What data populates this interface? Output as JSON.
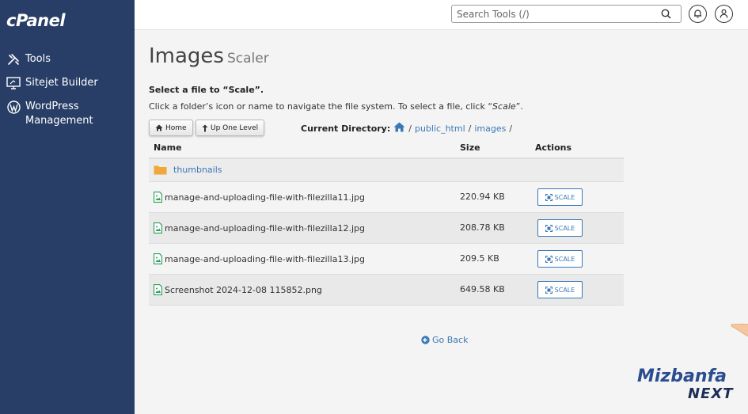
{
  "sidebar": {
    "logo": "cPanel",
    "items": [
      {
        "label": "Tools",
        "icon": "tools-icon"
      },
      {
        "label": "Sitejet Builder",
        "icon": "monitor-icon"
      },
      {
        "label": "WordPress Management",
        "icon": "wordpress-icon"
      }
    ]
  },
  "topbar": {
    "search_placeholder": "Search Tools (/)"
  },
  "page": {
    "title": "Images",
    "subtitle": "Scaler",
    "instruction_bold": "Select a file to “Scale”.",
    "instruction_prefix": "Click a folder’s icon or name to navigate the file system. To select a file, click “",
    "instruction_em": "Scale",
    "instruction_suffix": "”."
  },
  "toolbar": {
    "home_label": "Home",
    "up_label": "Up One Level"
  },
  "current_directory": {
    "label": "Current Directory:",
    "path": [
      "public_html",
      "images"
    ],
    "trailing_sep": "/"
  },
  "table": {
    "headers": {
      "name": "Name",
      "size": "Size",
      "actions": "Actions"
    },
    "folder": {
      "name": "thumbnails"
    },
    "files": [
      {
        "name": "manage-and-uploading-file-with-filezilla11.jpg",
        "size": "220.94 KB",
        "action": "SCALE"
      },
      {
        "name": "manage-and-uploading-file-with-filezilla12.jpg",
        "size": "208.78 KB",
        "action": "SCALE"
      },
      {
        "name": "manage-and-uploading-file-with-filezilla13.jpg",
        "size": "209.5 KB",
        "action": "SCALE"
      },
      {
        "name": "Screenshot 2024-12-08 115852.png",
        "size": "649.58 KB",
        "action": "SCALE"
      }
    ]
  },
  "footer": {
    "go_back": "Go Back"
  },
  "watermark": {
    "line1": "Mizbanfa",
    "line2": "NEXT"
  },
  "colors": {
    "sidebar_bg": "#283e67",
    "link": "#3b78b6",
    "file_icon": "#2e9e5b",
    "folder_icon": "#f0a83a"
  }
}
